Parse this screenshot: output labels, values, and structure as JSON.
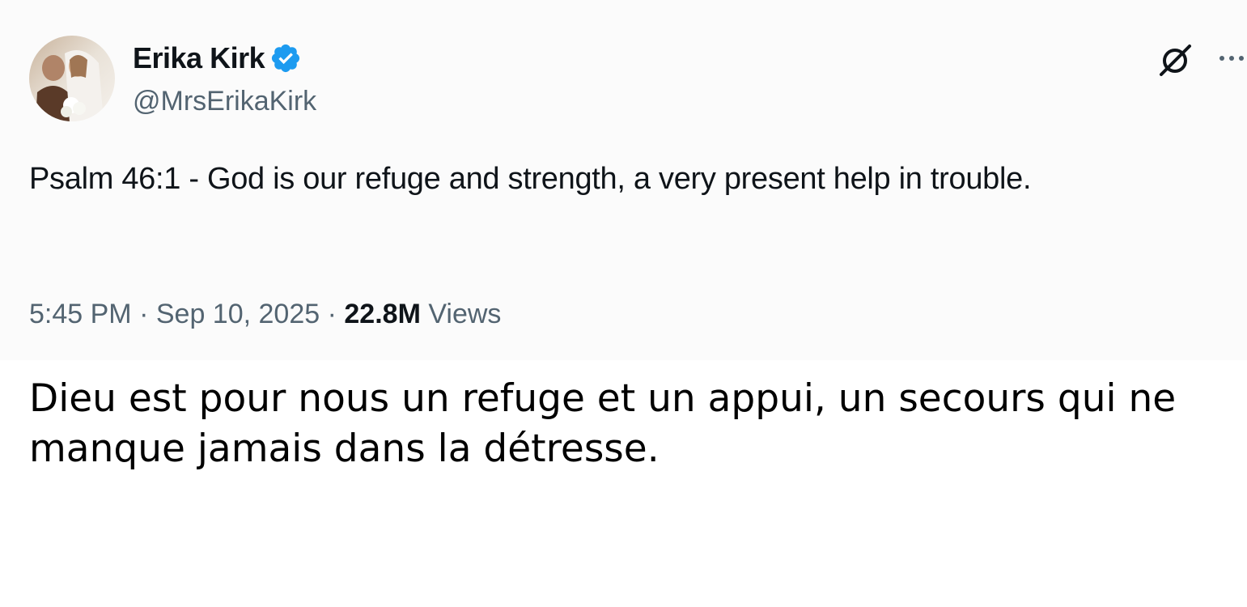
{
  "tweet": {
    "author": {
      "display_name": "Erika Kirk",
      "handle": "@MrsErikaKirk",
      "verified": true,
      "avatar_icon": "wedding-photo-avatar"
    },
    "text": "Psalm 46:1 - God is our refuge and strength, a very present help in trouble.",
    "time": "5:45 PM",
    "separator": "·",
    "date": "Sep 10, 2025",
    "views_count": "22.8M",
    "views_label": "Views",
    "actions": {
      "grok_icon": "grok-icon",
      "more_icon": "more-icon"
    }
  },
  "translation": {
    "text": "Dieu est pour nous un refuge et un appui, un secours qui ne manque jamais dans la détresse."
  },
  "colors": {
    "card_background": "#fbfbfb",
    "primary_text": "#0f1419",
    "secondary_text": "#536471",
    "verified_blue": "#1d9bf0"
  }
}
